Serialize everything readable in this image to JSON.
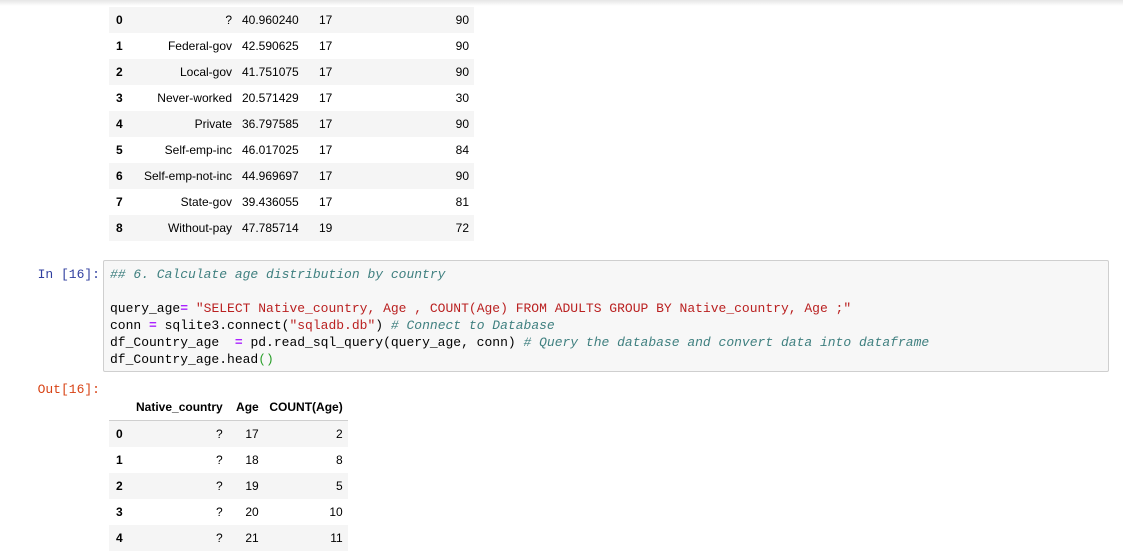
{
  "table1": {
    "rows": [
      {
        "index": "0",
        "workclass": "?",
        "mean": "40.960240",
        "min": "17",
        "max": "90"
      },
      {
        "index": "1",
        "workclass": "Federal-gov",
        "mean": "42.590625",
        "min": "17",
        "max": "90"
      },
      {
        "index": "2",
        "workclass": "Local-gov",
        "mean": "41.751075",
        "min": "17",
        "max": "90"
      },
      {
        "index": "3",
        "workclass": "Never-worked",
        "mean": "20.571429",
        "min": "17",
        "max": "30"
      },
      {
        "index": "4",
        "workclass": "Private",
        "mean": "36.797585",
        "min": "17",
        "max": "90"
      },
      {
        "index": "5",
        "workclass": "Self-emp-inc",
        "mean": "46.017025",
        "min": "17",
        "max": "84"
      },
      {
        "index": "6",
        "workclass": "Self-emp-not-inc",
        "mean": "44.969697",
        "min": "17",
        "max": "90"
      },
      {
        "index": "7",
        "workclass": "State-gov",
        "mean": "39.436055",
        "min": "17",
        "max": "81"
      },
      {
        "index": "8",
        "workclass": "Without-pay",
        "mean": "47.785714",
        "min": "19",
        "max": "72"
      }
    ]
  },
  "cell16": {
    "in_prompt": "In [16]:",
    "out_prompt": "Out[16]:",
    "code": {
      "l1_comment": "## 6. Calculate age distribution by country",
      "l3_a": "query_age",
      "l3_eq": "=",
      "l3_sp": " ",
      "l3_str": "\"SELECT Native_country, Age , COUNT(Age) FROM ADULTS GROUP BY Native_country, Age ;\"",
      "l4_a": "conn ",
      "l4_eq": "=",
      "l4_b": " sqlite3.connect(",
      "l4_str": "\"sqladb.db\"",
      "l4_c": ") ",
      "l4_comment": "# Connect to Database",
      "l5_a": "df_Country_age  ",
      "l5_eq": "=",
      "l5_b": " pd.read_sql_query(query_age, conn) ",
      "l5_comment": "# Query the database and convert data into dataframe",
      "l6_a": "df_Country_age.head",
      "l6_paren": "()"
    }
  },
  "table2": {
    "headers": [
      "",
      "Native_country",
      "Age",
      "COUNT(Age)"
    ],
    "rows": [
      {
        "index": "0",
        "country": "?",
        "age": "17",
        "count": "2"
      },
      {
        "index": "1",
        "country": "?",
        "age": "18",
        "count": "8"
      },
      {
        "index": "2",
        "country": "?",
        "age": "19",
        "count": "5"
      },
      {
        "index": "3",
        "country": "?",
        "age": "20",
        "count": "10"
      },
      {
        "index": "4",
        "country": "?",
        "age": "21",
        "count": "11"
      }
    ]
  }
}
